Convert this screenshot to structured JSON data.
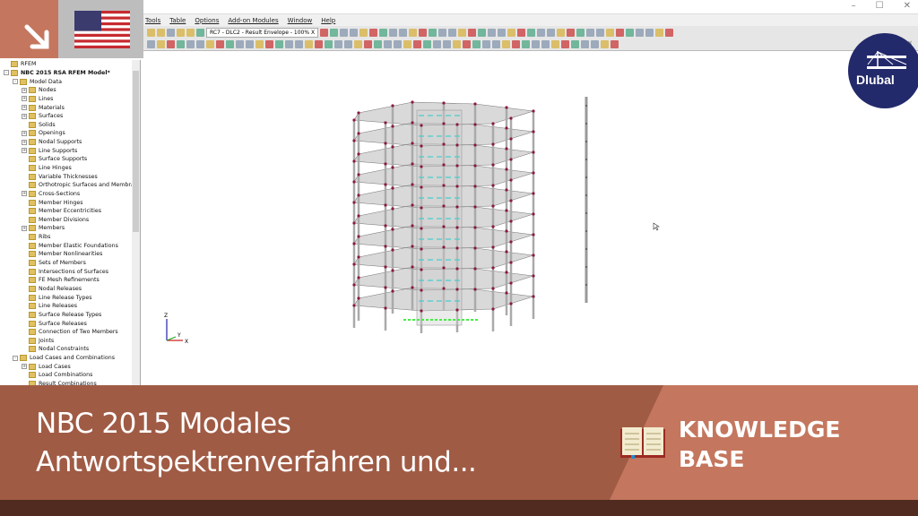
{
  "window": {
    "minimize": "–",
    "maximize": "☐",
    "close": "✕"
  },
  "menu": [
    "Tools",
    "Table",
    "Options",
    "Add-on Modules",
    "Window",
    "Help"
  ],
  "toolbar": {
    "result_combo": "RC7 - DLC2 - Result Envelope - 100% X"
  },
  "tree": [
    {
      "label": "RFEM",
      "level": 0,
      "pm": ""
    },
    {
      "label": "NBC 2015 RSA RFEM Model*",
      "level": 0,
      "pm": "−",
      "bold": true
    },
    {
      "label": "Model Data",
      "level": 1,
      "pm": "−"
    },
    {
      "label": "Nodes",
      "level": 2,
      "pm": "+"
    },
    {
      "label": "Lines",
      "level": 2,
      "pm": "+"
    },
    {
      "label": "Materials",
      "level": 2,
      "pm": "+"
    },
    {
      "label": "Surfaces",
      "level": 2,
      "pm": "+"
    },
    {
      "label": "Solids",
      "level": 2,
      "pm": ""
    },
    {
      "label": "Openings",
      "level": 2,
      "pm": "+"
    },
    {
      "label": "Nodal Supports",
      "level": 2,
      "pm": "+"
    },
    {
      "label": "Line Supports",
      "level": 2,
      "pm": "+"
    },
    {
      "label": "Surface Supports",
      "level": 2,
      "pm": ""
    },
    {
      "label": "Line Hinges",
      "level": 2,
      "pm": ""
    },
    {
      "label": "Variable Thicknesses",
      "level": 2,
      "pm": ""
    },
    {
      "label": "Orthotropic Surfaces and Membra",
      "level": 2,
      "pm": ""
    },
    {
      "label": "Cross-Sections",
      "level": 2,
      "pm": "+"
    },
    {
      "label": "Member Hinges",
      "level": 2,
      "pm": ""
    },
    {
      "label": "Member Eccentricities",
      "level": 2,
      "pm": ""
    },
    {
      "label": "Member Divisions",
      "level": 2,
      "pm": ""
    },
    {
      "label": "Members",
      "level": 2,
      "pm": "+"
    },
    {
      "label": "Ribs",
      "level": 2,
      "pm": ""
    },
    {
      "label": "Member Elastic Foundations",
      "level": 2,
      "pm": ""
    },
    {
      "label": "Member Nonlinearities",
      "level": 2,
      "pm": ""
    },
    {
      "label": "Sets of Members",
      "level": 2,
      "pm": ""
    },
    {
      "label": "Intersections of Surfaces",
      "level": 2,
      "pm": ""
    },
    {
      "label": "FE Mesh Refinements",
      "level": 2,
      "pm": ""
    },
    {
      "label": "Nodal Releases",
      "level": 2,
      "pm": ""
    },
    {
      "label": "Line Release Types",
      "level": 2,
      "pm": ""
    },
    {
      "label": "Line Releases",
      "level": 2,
      "pm": ""
    },
    {
      "label": "Surface Release Types",
      "level": 2,
      "pm": ""
    },
    {
      "label": "Surface Releases",
      "level": 2,
      "pm": ""
    },
    {
      "label": "Connection of Two Members",
      "level": 2,
      "pm": ""
    },
    {
      "label": "Joints",
      "level": 2,
      "pm": ""
    },
    {
      "label": "Nodal Constraints",
      "level": 2,
      "pm": ""
    },
    {
      "label": "Load Cases and Combinations",
      "level": 1,
      "pm": "−"
    },
    {
      "label": "Load Cases",
      "level": 2,
      "pm": "+"
    },
    {
      "label": "Load Combinations",
      "level": 2,
      "pm": ""
    },
    {
      "label": "Result Combinations",
      "level": 2,
      "pm": ""
    }
  ],
  "axes": {
    "z": "Z",
    "x": "X",
    "y": "Y"
  },
  "logo": {
    "text": "Dlubal"
  },
  "banner": {
    "title_line1": "NBC 2015 Modales",
    "title_line2": "Antwortspektrenverfahren und...",
    "kb_line1": "KNOWLEDGE",
    "kb_line2": "BASE"
  },
  "colors": {
    "accent": "#c4775e",
    "accent_dark": "#a05b45",
    "footer": "#512b20",
    "logo": "#232a6b"
  }
}
